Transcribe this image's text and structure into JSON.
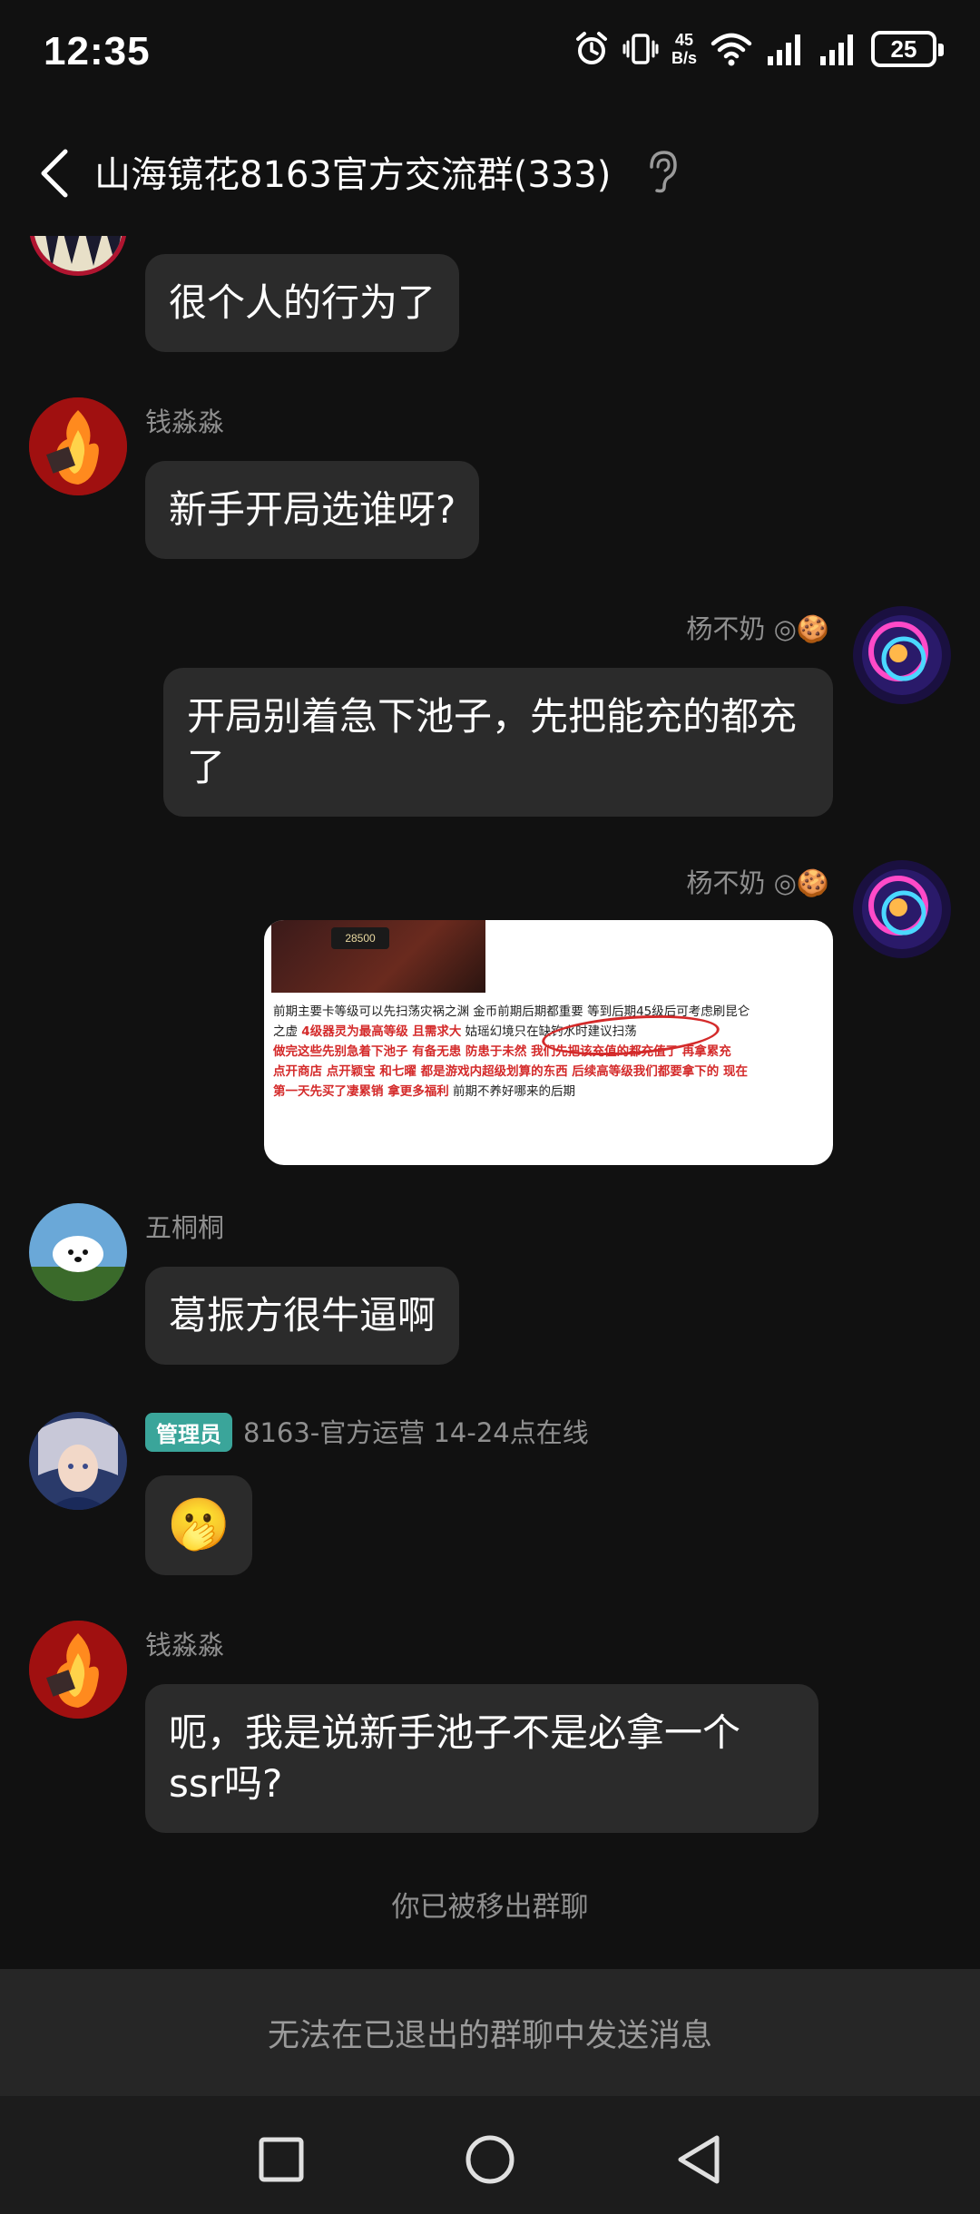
{
  "status_bar": {
    "time": "12:35",
    "net_speed_value": "45",
    "net_speed_unit": "B/s",
    "battery": "25"
  },
  "header": {
    "title": "山海镜花8163官方交流群(333)"
  },
  "messages": [
    {
      "sender": "",
      "text": "很个人的行为了",
      "side": "left"
    },
    {
      "sender": "钱淼淼",
      "text": "新手开局选谁呀?",
      "side": "left"
    },
    {
      "sender": "杨不奶",
      "text": "开局别着急下池子，先把能充的都充了",
      "side": "right"
    },
    {
      "sender": "杨不奶",
      "type": "image",
      "side": "right",
      "image_lines": {
        "coin": "28500",
        "line1": "前期主要卡等级可以先扫荡灾祸之渊  金币前期后期都重要  等到后期45级后可考虑刷昆仑",
        "line2a": "之虚  ",
        "line2b": "4级器灵为最高等级  且需求大",
        "line2c": "  姑瑶幻境只在缺钓水时建议扫荡",
        "line3": "做完这些先别急着下池子  有备无患  防患于未然  我们先把该充值的都充值了  再拿累充",
        "line4": "点开商店  点开颖宝  和七曜  都是游戏内超级划算的东西  后续高等级我们都要拿下的  现在",
        "line5a": "第一天先买了凄累销  拿更多福利",
        "line5b": "  前期不养好哪来的后期"
      }
    },
    {
      "sender": "五桐桐",
      "text": "葛振方很牛逼啊",
      "side": "left"
    },
    {
      "badge": "管理员",
      "sender": "8163-官方运营 14-24点在线",
      "emoji": "🫢",
      "side": "left"
    },
    {
      "sender": "钱淼淼",
      "text": "呃，我是说新手池子不是必拿一个ssr吗?",
      "side": "left"
    }
  ],
  "system_notice": "你已被移出群聊",
  "input_disabled_text": "无法在已退出的群聊中发送消息",
  "icons": [
    "back-arrow-icon",
    "ear-icon",
    "alarm-icon",
    "vibrate-icon",
    "wifi-icon",
    "signal-icon",
    "battery-icon",
    "square-icon",
    "circle-icon",
    "triangle-back-icon"
  ]
}
